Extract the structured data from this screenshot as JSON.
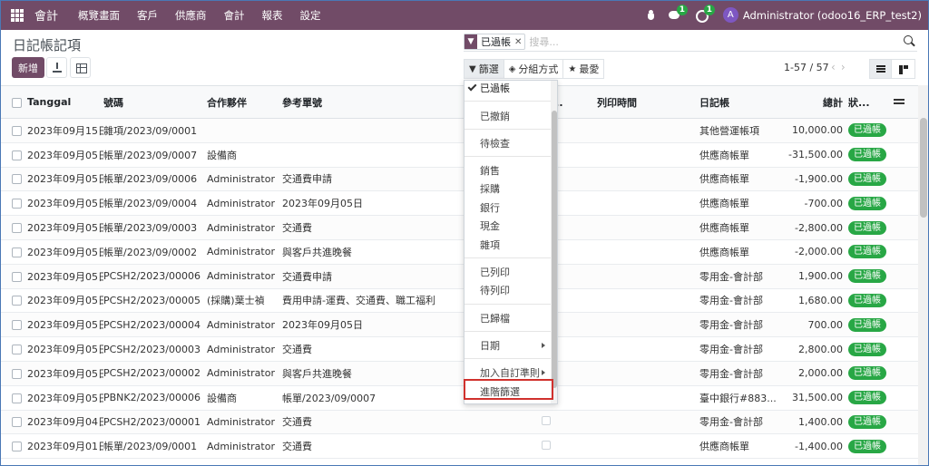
{
  "navbar": {
    "brand": "會計",
    "menu": [
      "概覽畫面",
      "客戶",
      "供應商",
      "會計",
      "報表",
      "設定"
    ],
    "chat_count": "1",
    "activity_count": "1",
    "avatar_letter": "A",
    "user": "Administrator (odoo16_ERP_test2)"
  },
  "page": {
    "title": "日記帳記項",
    "new_label": "新增"
  },
  "search": {
    "facet_label": "已過帳",
    "placeholder": "搜尋..."
  },
  "toolbar": {
    "filters_label": "篩選",
    "group_by_label": "分組方式",
    "favorites_label": "最愛"
  },
  "pager": {
    "value": "1-57 / 57",
    "prev": "‹",
    "next": "›"
  },
  "table": {
    "headers": {
      "date": "Tanggal",
      "number": "號碼",
      "partner": "合作夥伴",
      "reference": "參考單號",
      "send_status": "狀...",
      "print_time": "列印時間",
      "journal": "日記帳",
      "total": "總計",
      "status": "狀..."
    },
    "rows": [
      {
        "date": "2023年09月15日",
        "number": "雜項/2023/09/0001",
        "partner": "",
        "reference": "",
        "journal": "其他營運帳項",
        "total": "10,000.00",
        "status": "已過帳"
      },
      {
        "date": "2023年09月05日",
        "number": "帳單/2023/09/0007",
        "partner": "設備商",
        "reference": "",
        "journal": "供應商帳單",
        "total": "-31,500.00",
        "status": "已過帳"
      },
      {
        "date": "2023年09月05日",
        "number": "帳單/2023/09/0006",
        "partner": "Administrator",
        "reference": "交通費申請",
        "journal": "供應商帳單",
        "total": "-1,900.00",
        "status": "已過帳"
      },
      {
        "date": "2023年09月05日",
        "number": "帳單/2023/09/0004",
        "partner": "Administrator",
        "reference": "2023年09月05日",
        "journal": "供應商帳單",
        "total": "-700.00",
        "status": "已過帳"
      },
      {
        "date": "2023年09月05日",
        "number": "帳單/2023/09/0003",
        "partner": "Administrator",
        "reference": "交通費",
        "journal": "供應商帳單",
        "total": "-2,800.00",
        "status": "已過帳"
      },
      {
        "date": "2023年09月05日",
        "number": "帳單/2023/09/0002",
        "partner": "Administrator",
        "reference": "與客戶共進晚餐",
        "journal": "供應商帳單",
        "total": "-2,000.00",
        "status": "已過帳"
      },
      {
        "date": "2023年09月05日",
        "number": "PCSH2/2023/00006",
        "partner": "Administrator",
        "reference": "交通費申請",
        "journal": "零用金-會計部",
        "total": "1,900.00",
        "status": "已過帳"
      },
      {
        "date": "2023年09月05日",
        "number": "PCSH2/2023/00005",
        "partner": "(採購)葉士禎",
        "reference": "費用申請-運費、交通費、職工福利",
        "journal": "零用金-會計部",
        "total": "1,680.00",
        "status": "已過帳"
      },
      {
        "date": "2023年09月05日",
        "number": "PCSH2/2023/00004",
        "partner": "Administrator",
        "reference": "2023年09月05日",
        "journal": "零用金-會計部",
        "total": "700.00",
        "status": "已過帳"
      },
      {
        "date": "2023年09月05日",
        "number": "PCSH2/2023/00003",
        "partner": "Administrator",
        "reference": "交通費",
        "journal": "零用金-會計部",
        "total": "2,800.00",
        "status": "已過帳"
      },
      {
        "date": "2023年09月05日",
        "number": "PCSH2/2023/00002",
        "partner": "Administrator",
        "reference": "與客戶共進晚餐",
        "journal": "零用金-會計部",
        "total": "2,000.00",
        "status": "已過帳"
      },
      {
        "date": "2023年09月05日",
        "number": "PBNK2/2023/00006",
        "partner": "設備商",
        "reference": "帳單/2023/09/0007",
        "journal": "臺中銀行#883...",
        "total": "31,500.00",
        "status": "已過帳"
      },
      {
        "date": "2023年09月04日",
        "number": "PCSH2/2023/00001",
        "partner": "Administrator",
        "reference": "交通費",
        "journal": "零用金-會計部",
        "total": "1,400.00",
        "status": "已過帳"
      },
      {
        "date": "2023年09月01日",
        "number": "帳單/2023/09/0001",
        "partner": "Administrator",
        "reference": "交通費",
        "journal": "供應商帳單",
        "total": "-1,400.00",
        "status": "已過帳"
      }
    ]
  },
  "filter_menu": {
    "items": [
      "已過帳",
      "已撤銷",
      "待檢查",
      "銷售",
      "採購",
      "銀行",
      "現金",
      "雜項",
      "已列印",
      "待列印",
      "已歸檔",
      "日期",
      "加入自訂準則",
      "進階篩選"
    ]
  },
  "colors": {
    "brand": "#714b67",
    "status_posted": "#28a745",
    "highlight": "#d0312d"
  }
}
